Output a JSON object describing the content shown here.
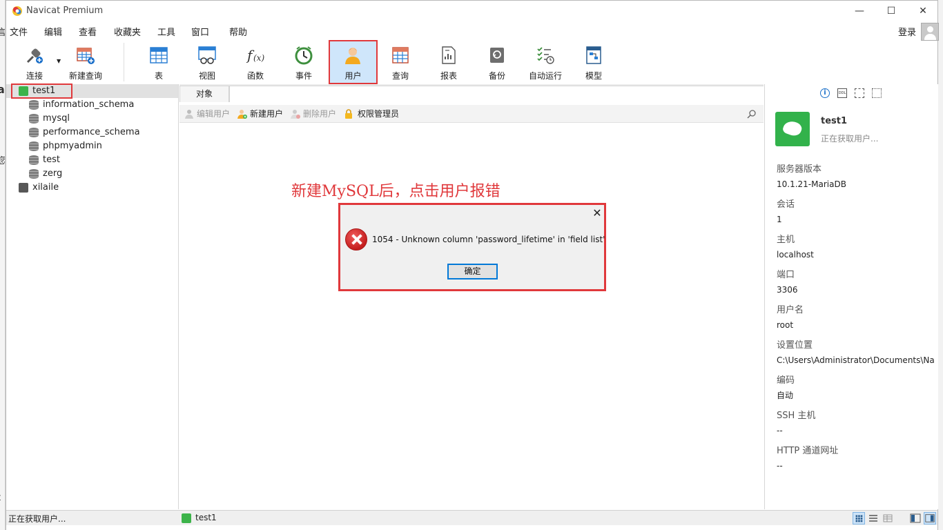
{
  "window": {
    "title": "Navicat Premium",
    "controls": {
      "minimize": "—",
      "maximize": "☐",
      "close": "✕"
    }
  },
  "menu": [
    "文件",
    "编辑",
    "查看",
    "收藏夹",
    "工具",
    "窗口",
    "帮助"
  ],
  "account": {
    "login_label": "登录"
  },
  "toolbar": {
    "connect": "连接",
    "new_query": "新建查询",
    "table": "表",
    "view": "视图",
    "function": "函数",
    "event": "事件",
    "user": "用户",
    "query": "查询",
    "report": "报表",
    "backup": "备份",
    "automation": "自动运行",
    "model": "模型"
  },
  "tree": {
    "connection": "test1",
    "databases": [
      "information_schema",
      "mysql",
      "performance_schema",
      "phpmyadmin",
      "test",
      "zerg"
    ],
    "other_connection": "xilaile"
  },
  "tabs": {
    "objects": "对象"
  },
  "object_toolbar": {
    "edit_user": "编辑用户",
    "new_user": "新建用户",
    "delete_user": "删除用户",
    "privilege_manager": "权限管理员"
  },
  "annotation": "新建MySQL后，点击用户报错",
  "dialog": {
    "message": "1054 - Unknown column 'password_lifetime' in 'field list'",
    "ok_label": "确定",
    "close": "✕"
  },
  "info_panel": {
    "tools": {
      "ddl": "DDL"
    },
    "connection_name": "test1",
    "status": "正在获取用户...",
    "fields": [
      {
        "label": "服务器版本",
        "value": "10.1.21-MariaDB"
      },
      {
        "label": "会话",
        "value": "1"
      },
      {
        "label": "主机",
        "value": "localhost"
      },
      {
        "label": "端口",
        "value": "3306"
      },
      {
        "label": "用户名",
        "value": "root"
      },
      {
        "label": "设置位置",
        "value": "C:\\Users\\Administrator\\Documents\\Na"
      },
      {
        "label": "编码",
        "value": "自动"
      },
      {
        "label": "SSH 主机",
        "value": "--"
      },
      {
        "label": "HTTP 通道网址",
        "value": "--"
      }
    ]
  },
  "statusbar": {
    "left_text": "正在获取用户...",
    "connection": "test1"
  },
  "colors": {
    "highlight_red": "#e0383b",
    "selected_tool_bg": "#cfe6fb",
    "connection_green": "#3cb34a"
  }
}
